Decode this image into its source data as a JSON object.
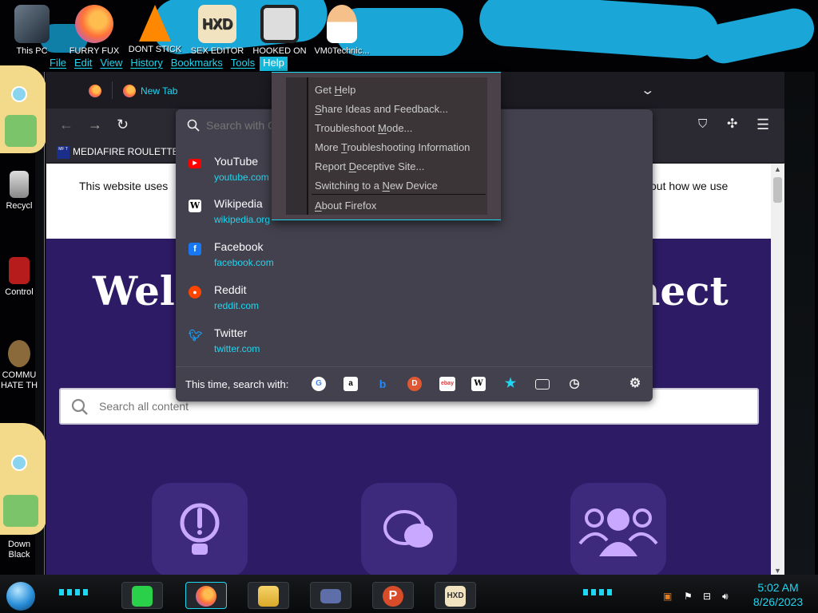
{
  "desktop": {
    "icons": [
      {
        "label": "This PC"
      },
      {
        "label": "FURRY FUX"
      },
      {
        "label": "DONT STICK"
      },
      {
        "label": "SEX EDITOR"
      },
      {
        "label": "HOOKED ON"
      },
      {
        "label": "VM0Technic..."
      }
    ],
    "side_icons": [
      {
        "label": "Recycl"
      },
      {
        "label": "Control"
      },
      {
        "label": "COMMU HATE TH"
      },
      {
        "label": "Down Black"
      }
    ]
  },
  "menubar": {
    "file": "File",
    "edit": "Edit",
    "view": "View",
    "history": "History",
    "bookmarks": "Bookmarks",
    "tools": "Tools",
    "help": "Help"
  },
  "browser": {
    "tab_title": "New Tab",
    "bookmark": {
      "label": "MEDIAFIRE ROULETTER",
      "favicon_text": "MF T"
    },
    "page": {
      "cookie_text_left": "This website uses",
      "cookie_text_right": "out how we use",
      "welcome_left": "Welc",
      "welcome_right": "nect",
      "search_placeholder": "Search all content"
    }
  },
  "urlbar": {
    "placeholder": "Search with G",
    "suggestions": [
      {
        "title": "YouTube",
        "url": "youtube.com",
        "icon": "youtube-icon",
        "color": "#ff0000"
      },
      {
        "title": "Wikipedia",
        "url": "wikipedia.org",
        "icon": "wikipedia-icon",
        "color": "#ffffff"
      },
      {
        "title": "Facebook",
        "url": "facebook.com",
        "icon": "facebook-icon",
        "color": "#1877f2"
      },
      {
        "title": "Reddit",
        "url": "reddit.com",
        "icon": "reddit-icon",
        "color": "#ff4500"
      },
      {
        "title": "Twitter",
        "url": "twitter.com",
        "icon": "twitter-icon",
        "color": "#1d9bf0"
      }
    ],
    "search_with_label": "This time, search with:",
    "engines": [
      "google-icon",
      "amazon-icon",
      "bing-icon",
      "duckduckgo-icon",
      "ebay-icon",
      "wikipedia-icon",
      "bookmarks-star-icon",
      "tabs-icon",
      "history-icon"
    ]
  },
  "help_menu": {
    "get_help": {
      "before": "Get ",
      "key": "H",
      "after": "elp"
    },
    "share": {
      "before": "",
      "key": "S",
      "after": "hare Ideas and Feedback..."
    },
    "troubleshoot": {
      "before": "Troubleshoot ",
      "key": "M",
      "after": "ode..."
    },
    "more_troubleshoot": {
      "before": "More ",
      "key": "T",
      "after": "roubleshooting Information"
    },
    "report": {
      "before": "Report ",
      "key": "D",
      "after": "eceptive Site..."
    },
    "switching": {
      "before": "Switching to a ",
      "key": "N",
      "after": "ew Device"
    },
    "about": {
      "before": "",
      "key": "A",
      "after": "bout Firefox"
    }
  },
  "taskbar": {
    "time": "5:02 AM",
    "date": "8/26/2023",
    "accent": "#1fd7f2"
  }
}
